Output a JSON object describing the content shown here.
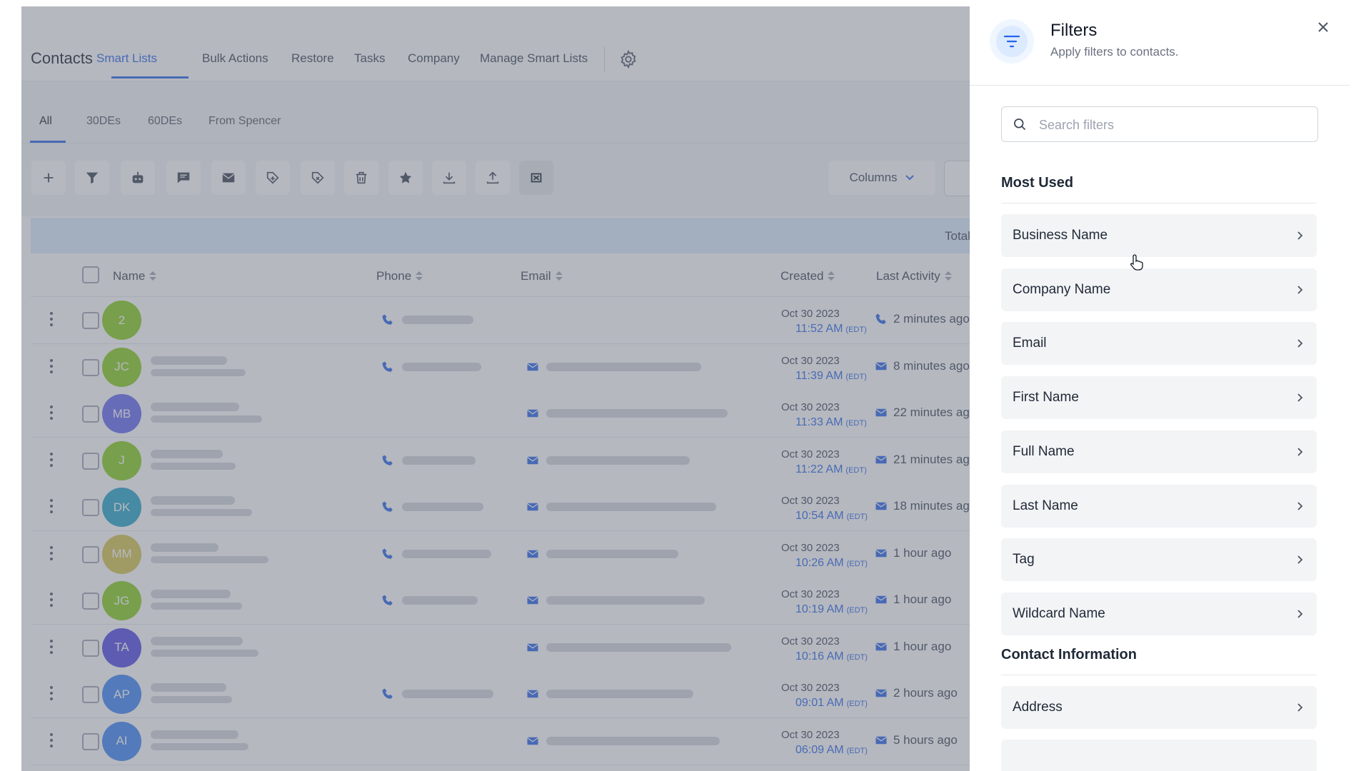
{
  "app": {
    "title": "Contacts"
  },
  "topnav": {
    "tabs": [
      "Smart Lists",
      "Bulk Actions",
      "Restore",
      "Tasks",
      "Company",
      "Manage Smart Lists"
    ],
    "active": "Smart Lists"
  },
  "subnav": {
    "tabs": [
      "All",
      "30DEs",
      "60DEs",
      "From Spencer"
    ],
    "active": "All"
  },
  "toolbar": {
    "icons": [
      "plus-icon",
      "filter-icon",
      "robot-icon",
      "message-icon",
      "mail-icon",
      "tag-add-icon",
      "tag-remove-icon",
      "trash-icon",
      "star-icon",
      "download-icon",
      "upload-icon",
      "merge-icon"
    ],
    "columns_label": "Columns"
  },
  "table": {
    "total_label": "Total",
    "headers": {
      "name": "Name",
      "phone": "Phone",
      "email": "Email",
      "created": "Created",
      "last_activity": "Last Activity"
    },
    "rows": [
      {
        "initials": "2",
        "color": "#84cc16",
        "phone": true,
        "email": false,
        "date": "Oct 30 2023",
        "time": "11:52 AM",
        "tz": "(EDT)",
        "activity_icon": "phone",
        "activity": "2 minutes ago"
      },
      {
        "initials": "JC",
        "color": "#84cc16",
        "phone": true,
        "email": true,
        "date": "Oct 30 2023",
        "time": "11:39 AM",
        "tz": "(EDT)",
        "activity_icon": "mail",
        "activity": "8 minutes ago"
      },
      {
        "initials": "MB",
        "color": "#6366f1",
        "phone": false,
        "email": true,
        "date": "Oct 30 2023",
        "time": "11:33 AM",
        "tz": "(EDT)",
        "activity_icon": "mail",
        "activity": "22 minutes ag"
      },
      {
        "initials": "J",
        "color": "#84cc16",
        "phone": true,
        "email": true,
        "date": "Oct 30 2023",
        "time": "11:22 AM",
        "tz": "(EDT)",
        "activity_icon": "mail",
        "activity": "21 minutes ag"
      },
      {
        "initials": "DK",
        "color": "#22a3c7",
        "phone": true,
        "email": true,
        "date": "Oct 30 2023",
        "time": "10:54 AM",
        "tz": "(EDT)",
        "activity_icon": "mail",
        "activity": "18 minutes ag"
      },
      {
        "initials": "MM",
        "color": "#d4c24a",
        "phone": true,
        "email": true,
        "date": "Oct 30 2023",
        "time": "10:26 AM",
        "tz": "(EDT)",
        "activity_icon": "mail",
        "activity": "1 hour ago"
      },
      {
        "initials": "JG",
        "color": "#84cc16",
        "phone": true,
        "email": true,
        "date": "Oct 30 2023",
        "time": "10:19 AM",
        "tz": "(EDT)",
        "activity_icon": "mail",
        "activity": "1 hour ago"
      },
      {
        "initials": "TA",
        "color": "#4f46e5",
        "phone": false,
        "email": true,
        "date": "Oct 30 2023",
        "time": "10:16 AM",
        "tz": "(EDT)",
        "activity_icon": "mail",
        "activity": "1 hour ago"
      },
      {
        "initials": "AP",
        "color": "#3b82f6",
        "phone": true,
        "email": true,
        "date": "Oct 30 2023",
        "time": "09:01 AM",
        "tz": "(EDT)",
        "activity_icon": "mail",
        "activity": "2 hours ago"
      },
      {
        "initials": "AI",
        "color": "#3b82f6",
        "phone": false,
        "email": true,
        "date": "Oct 30 2023",
        "time": "06:09 AM",
        "tz": "(EDT)",
        "activity_icon": "mail",
        "activity": "5 hours ago"
      }
    ]
  },
  "filters": {
    "title": "Filters",
    "subtitle": "Apply filters to contacts.",
    "search_placeholder": "Search filters",
    "sections": [
      {
        "title": "Most Used",
        "items": [
          "Business Name",
          "Company Name",
          "Email",
          "First Name",
          "Full Name",
          "Last Name",
          "Tag",
          "Wildcard Name"
        ]
      },
      {
        "title": "Contact Information",
        "items": [
          "Address"
        ]
      }
    ]
  },
  "colors": {
    "accent": "#2563eb",
    "overlay": "rgba(107,114,128,0.5)"
  }
}
